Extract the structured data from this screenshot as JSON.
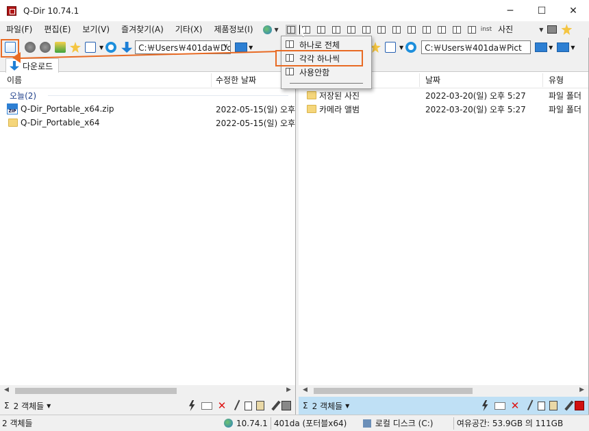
{
  "window": {
    "title": "Q-Dir 10.74.1",
    "minimize": "─",
    "maximize": "☐",
    "close": "✕"
  },
  "menu": {
    "items": [
      "파일(F)",
      "편집(E)",
      "보기(V)",
      "즐겨찾기(A)",
      "기타(X)",
      "제품정보(I)"
    ],
    "right_text": "사진",
    "inst": "inst"
  },
  "left_pane": {
    "path": "C:￦Users￦401da￦Dov",
    "tab_label": "다운로드",
    "columns": [
      "이름",
      "수정한 날짜"
    ],
    "group": "오늘(2)",
    "files": [
      {
        "name": "Q-Dir_Portable_x64.zip",
        "date": "2022-05-15(일) 오후"
      },
      {
        "name": "Q-Dir_Portable_x64",
        "date": "2022-05-15(일) 오후"
      }
    ],
    "count": "2 객체들"
  },
  "right_pane": {
    "path": "C:￦Users￦401da￦Pict",
    "columns": [
      "날짜",
      "유형"
    ],
    "files": [
      {
        "name": "저장된 사진",
        "date": "2022-03-20(일) 오후 5:27",
        "type": "파일 폴더"
      },
      {
        "name": "카메라 앨범",
        "date": "2022-03-20(일) 오후 5:27",
        "type": "파일 폴더"
      }
    ],
    "count": "2 객체들"
  },
  "dropdown_menu": {
    "items": [
      "하나로 전체",
      "각각 하나씩",
      "사용안함"
    ],
    "highlighted_index": 1
  },
  "status": {
    "left": "2 객체들",
    "version": "10.74.1",
    "user": "401da (포터블x64)",
    "disk": "로컬 디스크 (C:)",
    "free": "여유공간: 53.9GB 의 111GB"
  },
  "colors": {
    "highlight": "#e86a23",
    "accent": "#1d7fd6",
    "group_text": "#1e3f8a",
    "right_bottom_bar": "#bfe0f5"
  }
}
